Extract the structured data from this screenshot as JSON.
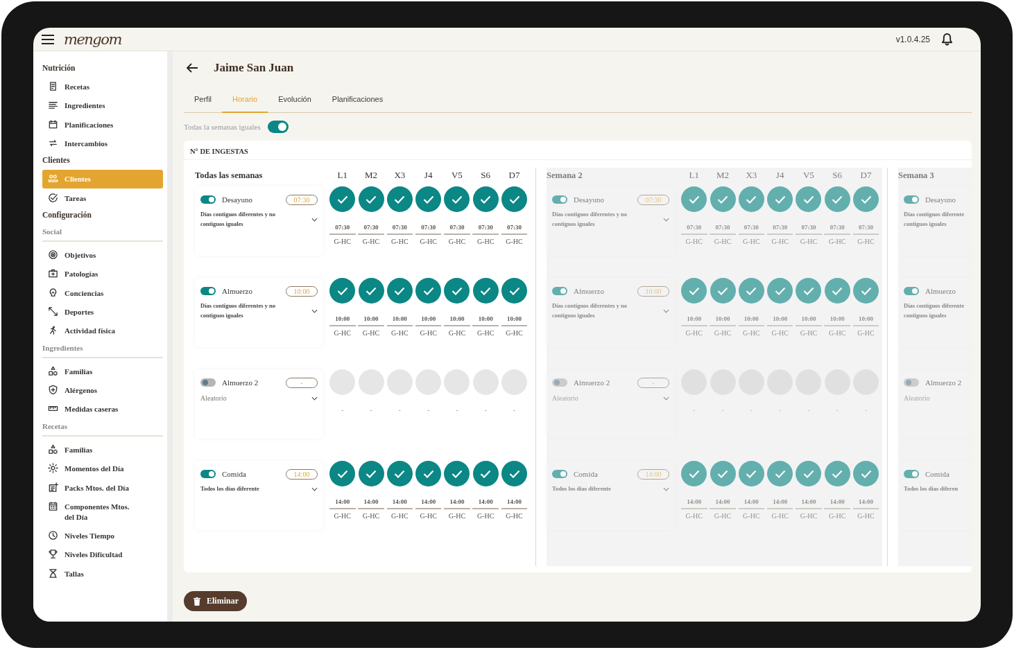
{
  "app": {
    "logo": "mengom",
    "version": "v1.0.4.25"
  },
  "sidebar": [
    {
      "title": "Nutrición",
      "kind": "heading",
      "items": [
        {
          "label": "Recetas",
          "selected": false
        },
        {
          "label": "Ingredientes",
          "selected": false
        },
        {
          "label": "Planificaciones",
          "selected": false
        },
        {
          "label": "Intercambios",
          "selected": false
        }
      ]
    },
    {
      "title": "Clientes",
      "kind": "heading",
      "items": [
        {
          "label": "Clientes",
          "selected": true
        },
        {
          "label": "Tareas",
          "selected": false
        }
      ]
    },
    {
      "title": "Configuración",
      "kind": "heading"
    },
    {
      "title": "Social",
      "kind": "subheading",
      "items": [
        {
          "label": "Objetivos",
          "selected": false
        },
        {
          "label": "Patologías",
          "selected": false
        },
        {
          "label": "Conciencias",
          "selected": false
        },
        {
          "label": "Deportes",
          "selected": false
        },
        {
          "label": "Actividad física",
          "selected": false
        }
      ]
    },
    {
      "title": "Ingredientes",
      "kind": "subheading",
      "items": [
        {
          "label": "Familias",
          "selected": false
        },
        {
          "label": "Alérgenos",
          "selected": false
        },
        {
          "label": "Medidas caseras",
          "selected": false
        }
      ]
    },
    {
      "title": "Recetas",
      "kind": "subheading",
      "items": [
        {
          "label": "Familias",
          "selected": false
        },
        {
          "label": "Momentos del Día",
          "selected": false
        },
        {
          "label": "Packs Mtos. del Día",
          "selected": false
        },
        {
          "label": "Componentes Mtos. del Día",
          "selected": false
        },
        {
          "label": "Niveles Tiempo",
          "selected": false
        },
        {
          "label": "Niveles Dificultad",
          "selected": false
        },
        {
          "label": "Tallas",
          "selected": false
        }
      ]
    }
  ],
  "page": {
    "title": "Jaime San Juan",
    "tabs": [
      {
        "label": "Perfil",
        "selected": false
      },
      {
        "label": "Horario",
        "selected": true
      },
      {
        "label": "Evolución",
        "selected": false
      },
      {
        "label": "Planificaciones",
        "selected": false
      }
    ]
  },
  "same_weeks": {
    "label": "Todas la semanas iguales",
    "on": true
  },
  "panel": {
    "title": "N° DE INGESTAS",
    "weeks": [
      {
        "title": "Todas las semanas",
        "disabled": false,
        "days": [
          "L1",
          "M2",
          "X3",
          "J4",
          "V5",
          "S6",
          "D7"
        ],
        "meals": [
          {
            "name": "Desayuno",
            "on": true,
            "time": "07:30",
            "mode": "Días contiguos diferentes y no contiguos iguales",
            "days": [
              {
                "checked": true,
                "time": "07:30",
                "group": "G-HC"
              },
              {
                "checked": true,
                "time": "07:30",
                "group": "G-HC"
              },
              {
                "checked": true,
                "time": "07:30",
                "group": "G-HC"
              },
              {
                "checked": true,
                "time": "07:30",
                "group": "G-HC"
              },
              {
                "checked": true,
                "time": "07:30",
                "group": "G-HC"
              },
              {
                "checked": true,
                "time": "07:30",
                "group": "G-HC"
              },
              {
                "checked": true,
                "time": "07:30",
                "group": "G-HC"
              }
            ]
          },
          {
            "name": "Almuerzo",
            "on": true,
            "time": "10:00",
            "mode": "Días contiguos diferentes y no contiguos iguales",
            "days": [
              {
                "checked": true,
                "time": "10:00",
                "group": "G-HC"
              },
              {
                "checked": true,
                "time": "10:00",
                "group": "G-HC"
              },
              {
                "checked": true,
                "time": "10:00",
                "group": "G-HC"
              },
              {
                "checked": true,
                "time": "10:00",
                "group": "G-HC"
              },
              {
                "checked": true,
                "time": "10:00",
                "group": "G-HC"
              },
              {
                "checked": true,
                "time": "10:00",
                "group": "G-HC"
              },
              {
                "checked": true,
                "time": "10:00",
                "group": "G-HC"
              }
            ]
          },
          {
            "name": "Almuerzo 2",
            "on": false,
            "time": "-",
            "mode": "Aleatorio",
            "days": [
              {
                "checked": false,
                "time": "-"
              },
              {
                "checked": false,
                "time": "-"
              },
              {
                "checked": false,
                "time": "-"
              },
              {
                "checked": false,
                "time": "-"
              },
              {
                "checked": false,
                "time": "-"
              },
              {
                "checked": false,
                "time": "-"
              },
              {
                "checked": false,
                "time": "-"
              }
            ]
          },
          {
            "name": "Comida",
            "on": true,
            "time": "14:00",
            "mode": "Todos los días diferente",
            "days": [
              {
                "checked": true,
                "time": "14:00",
                "group": "G-HC"
              },
              {
                "checked": true,
                "time": "14:00",
                "group": "G-HC"
              },
              {
                "checked": true,
                "time": "14:00",
                "group": "G-HC"
              },
              {
                "checked": true,
                "time": "14:00",
                "group": "G-HC"
              },
              {
                "checked": true,
                "time": "14:00",
                "group": "G-HC"
              },
              {
                "checked": true,
                "time": "14:00",
                "group": "G-HC"
              },
              {
                "checked": true,
                "time": "14:00",
                "group": "G-HC"
              }
            ]
          }
        ]
      },
      {
        "title": "Semana 2",
        "disabled": true,
        "days": [
          "L1",
          "M2",
          "X3",
          "J4",
          "V5",
          "S6",
          "D7"
        ],
        "meals": [
          {
            "name": "Desayuno",
            "on": true,
            "time": "07:30",
            "mode": "Días contiguos diferentes y no contiguos iguales",
            "days": [
              {
                "checked": true,
                "time": "07:30",
                "group": "G-HC"
              },
              {
                "checked": true,
                "time": "07:30",
                "group": "G-HC"
              },
              {
                "checked": true,
                "time": "07:30",
                "group": "G-HC"
              },
              {
                "checked": true,
                "time": "07:30",
                "group": "G-HC"
              },
              {
                "checked": true,
                "time": "07:30",
                "group": "G-HC"
              },
              {
                "checked": true,
                "time": "07:30",
                "group": "G-HC"
              },
              {
                "checked": true,
                "time": "07:30",
                "group": "G-HC"
              }
            ]
          },
          {
            "name": "Almuerzo",
            "on": true,
            "time": "10:00",
            "mode": "Días contiguos diferentes y no contiguos iguales",
            "days": [
              {
                "checked": true,
                "time": "10:00",
                "group": "G-HC"
              },
              {
                "checked": true,
                "time": "10:00",
                "group": "G-HC"
              },
              {
                "checked": true,
                "time": "10:00",
                "group": "G-HC"
              },
              {
                "checked": true,
                "time": "10:00",
                "group": "G-HC"
              },
              {
                "checked": true,
                "time": "10:00",
                "group": "G-HC"
              },
              {
                "checked": true,
                "time": "10:00",
                "group": "G-HC"
              },
              {
                "checked": true,
                "time": "10:00",
                "group": "G-HC"
              }
            ]
          },
          {
            "name": "Almuerzo 2",
            "on": false,
            "time": "-",
            "mode": "Aleatorio",
            "days": [
              {
                "checked": false,
                "time": "-"
              },
              {
                "checked": false,
                "time": "-"
              },
              {
                "checked": false,
                "time": "-"
              },
              {
                "checked": false,
                "time": "-"
              },
              {
                "checked": false,
                "time": "-"
              },
              {
                "checked": false,
                "time": "-"
              },
              {
                "checked": false,
                "time": "-"
              }
            ]
          },
          {
            "name": "Comida",
            "on": true,
            "time": "14:00",
            "mode": "Todos los días diferente",
            "days": [
              {
                "checked": true,
                "time": "14:00",
                "group": "G-HC"
              },
              {
                "checked": true,
                "time": "14:00",
                "group": "G-HC"
              },
              {
                "checked": true,
                "time": "14:00",
                "group": "G-HC"
              },
              {
                "checked": true,
                "time": "14:00",
                "group": "G-HC"
              },
              {
                "checked": true,
                "time": "14:00",
                "group": "G-HC"
              },
              {
                "checked": true,
                "time": "14:00",
                "group": "G-HC"
              },
              {
                "checked": true,
                "time": "14:00",
                "group": "G-HC"
              }
            ]
          }
        ]
      },
      {
        "title": "Semana 3",
        "disabled": true,
        "meals": [
          {
            "name": "Desayuno",
            "on": true,
            "mode": "Días contiguos diferente\ncontiguos iguales"
          },
          {
            "name": "Almuerzo",
            "on": true,
            "mode": "Días contiguos diferente\ncontiguos iguales"
          },
          {
            "name": "Almuerzo 2",
            "on": false,
            "mode": "Aleatorio"
          },
          {
            "name": "Comida",
            "on": true,
            "mode": "Todos los días diferen"
          }
        ]
      }
    ]
  },
  "delete_button": "Eliminar"
}
